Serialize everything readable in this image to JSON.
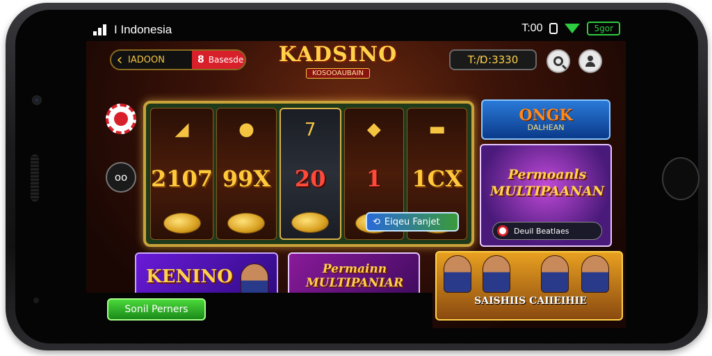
{
  "status_bar": {
    "carrier": "I Indonesia",
    "time": "T:00",
    "battery": "5gor"
  },
  "top_bar": {
    "back_label": "IADOON",
    "red_badge": "8",
    "red_label": "Basesde",
    "logo": "KADSINO",
    "logo_sub": "KOSOOAUBAIN",
    "balance": "T:/Ɒ:3330"
  },
  "side": {
    "dice_label": "oo"
  },
  "slot": {
    "reels": [
      {
        "symbol": "◢",
        "value": "2107",
        "red": false
      },
      {
        "symbol": "●",
        "value": "99X",
        "red": false
      },
      {
        "symbol": "7",
        "value": "20",
        "red": true
      },
      {
        "symbol": "◆",
        "value": "1",
        "red": true
      },
      {
        "symbol": "▬",
        "value": "1CX",
        "red": false
      }
    ],
    "action_label": "Eiqeu Fanjet"
  },
  "promo_top": {
    "title": "ONGK",
    "subtitle": "DALHEAN"
  },
  "promo_mid": {
    "title": "Permoanls MULTIPAANAN",
    "button": "Deuil Beatlaes"
  },
  "cards": {
    "keno": "KENINO",
    "multi": "Permainn MULTIPANIAR",
    "players": "SAISHIIS CAIIEIHIE"
  },
  "bottom": {
    "button": "Sonil Perners"
  },
  "colors": {
    "gold": "#ffd24a",
    "red": "#d8202a",
    "green": "#2ecc40"
  }
}
